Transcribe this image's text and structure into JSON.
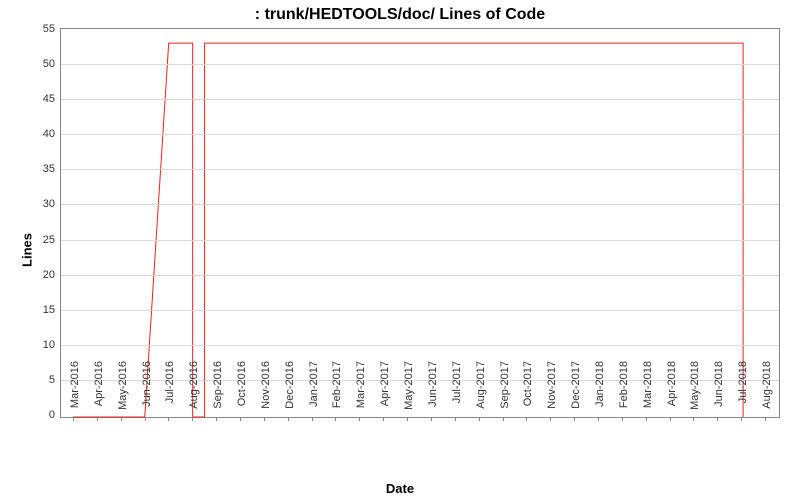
{
  "title_prefix": ": ",
  "title_main": "trunk/HEDTOOLS/doc/ Lines of Code",
  "xlabel": "Date",
  "ylabel": "Lines",
  "chart_data": {
    "type": "line",
    "title": "trunk/HEDTOOLS/doc/ Lines of Code",
    "xlabel": "Date",
    "ylabel": "Lines",
    "ylim": [
      0,
      55
    ],
    "ygrid_step": 5,
    "categories": [
      "Mar-2016",
      "Apr-2016",
      "May-2016",
      "Jun-2016",
      "Jul-2016",
      "Aug-2016",
      "Sep-2016",
      "Oct-2016",
      "Nov-2016",
      "Dec-2016",
      "Jan-2017",
      "Feb-2017",
      "Mar-2017",
      "Apr-2017",
      "May-2017",
      "Jun-2017",
      "Jul-2017",
      "Aug-2017",
      "Sep-2017",
      "Oct-2017",
      "Nov-2017",
      "Dec-2017",
      "Jan-2018",
      "Feb-2018",
      "Mar-2018",
      "Apr-2018",
      "May-2018",
      "Jun-2018",
      "Jul-2018",
      "Aug-2018"
    ],
    "series": [
      {
        "name": "Lines of Code",
        "color": "#ee2020",
        "points": [
          {
            "x": "Mar-2016",
            "y": 0
          },
          {
            "x": "Jun-2016",
            "y": 0
          },
          {
            "x": "Jul-2016",
            "y": 53
          },
          {
            "x": "Aug-2016",
            "y": 53
          },
          {
            "x": "Aug-2016",
            "y": 0
          },
          {
            "x": "mid-Aug-2016",
            "y": 0
          },
          {
            "x": "mid-Aug-2016",
            "y": 53
          },
          {
            "x": "Jul-2018",
            "y": 53
          },
          {
            "x": "Jul-2018",
            "y": 0
          }
        ]
      }
    ]
  }
}
